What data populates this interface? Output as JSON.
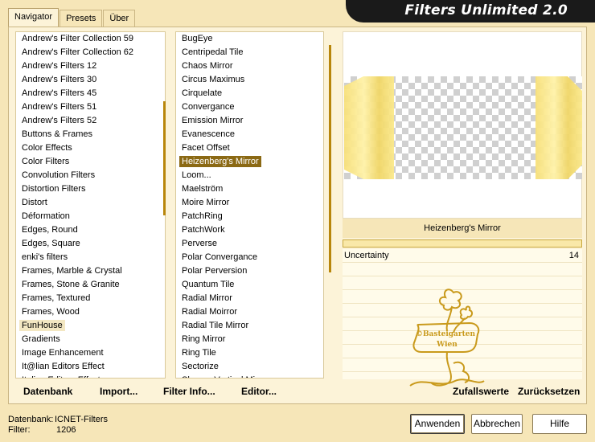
{
  "app": {
    "title": "Filters Unlimited 2.0"
  },
  "tabs": [
    {
      "label": "Navigator",
      "active": true
    },
    {
      "label": "Presets",
      "active": false
    },
    {
      "label": "Über",
      "active": false
    }
  ],
  "categories": [
    "Andrew's Filter Collection 59",
    "Andrew's Filter Collection 62",
    "Andrew's Filters 12",
    "Andrew's Filters 30",
    "Andrew's Filters 45",
    "Andrew's Filters 51",
    "Andrew's Filters 52",
    "Buttons & Frames",
    "Color Effects",
    "Color Filters",
    "Convolution Filters",
    "Distortion Filters",
    "Distort",
    "Déformation",
    "Edges, Round",
    "Edges, Square",
    "enki's filters",
    "Frames, Marble & Crystal",
    "Frames, Stone & Granite",
    "Frames, Textured",
    "Frames, Wood",
    "FunHouse",
    "Gradients",
    "Image Enhancement",
    "It@lian Editors Effect",
    "Italian Editors Effect"
  ],
  "selected_category": "FunHouse",
  "filters": [
    "BugEye",
    "Centripedal Tile",
    "Chaos Mirror",
    "Circus Maximus",
    "Cirquelate",
    "Convergance",
    "Emission Mirror",
    "Evanescence",
    "Facet Offset",
    "Heizenberg's Mirror",
    "Loom...",
    "Maelström",
    "Moire Mirror",
    "PatchRing",
    "PatchWork",
    "Perverse",
    "Polar Convergance",
    "Polar Perversion",
    "Quantum Tile",
    "Radial Mirror",
    "Radial Moirror",
    "Radial Tile Mirror",
    "Ring Mirror",
    "Ring Tile",
    "Sectorize",
    "Shaggy Vertical Mirror"
  ],
  "selected_filter": "Heizenberg's Mirror",
  "preview": {
    "filter_name": "Heizenberg's Mirror"
  },
  "parameters": [
    {
      "label": "Uncertainty",
      "value": "14"
    }
  ],
  "toolbar": {
    "database": "Datenbank",
    "import": "Import...",
    "filter_info": "Filter Info...",
    "editor": "Editor...",
    "random": "Zufallswerte",
    "reset": "Zurücksetzen"
  },
  "footer": {
    "database_label": "Datenbank:",
    "database_value": "ICNET-Filters",
    "filter_label": "Filter:",
    "filter_value": "1206"
  },
  "buttons": {
    "apply": "Anwenden",
    "cancel": "Abbrechen",
    "help": "Hilfe"
  },
  "watermark": {
    "line1": "©Basteigarten",
    "line2": "Wien"
  },
  "colors": {
    "background": "#f6e6b8",
    "panel": "#fcf3d8",
    "accent": "#8b6914",
    "banner": "#1a1a1a"
  }
}
